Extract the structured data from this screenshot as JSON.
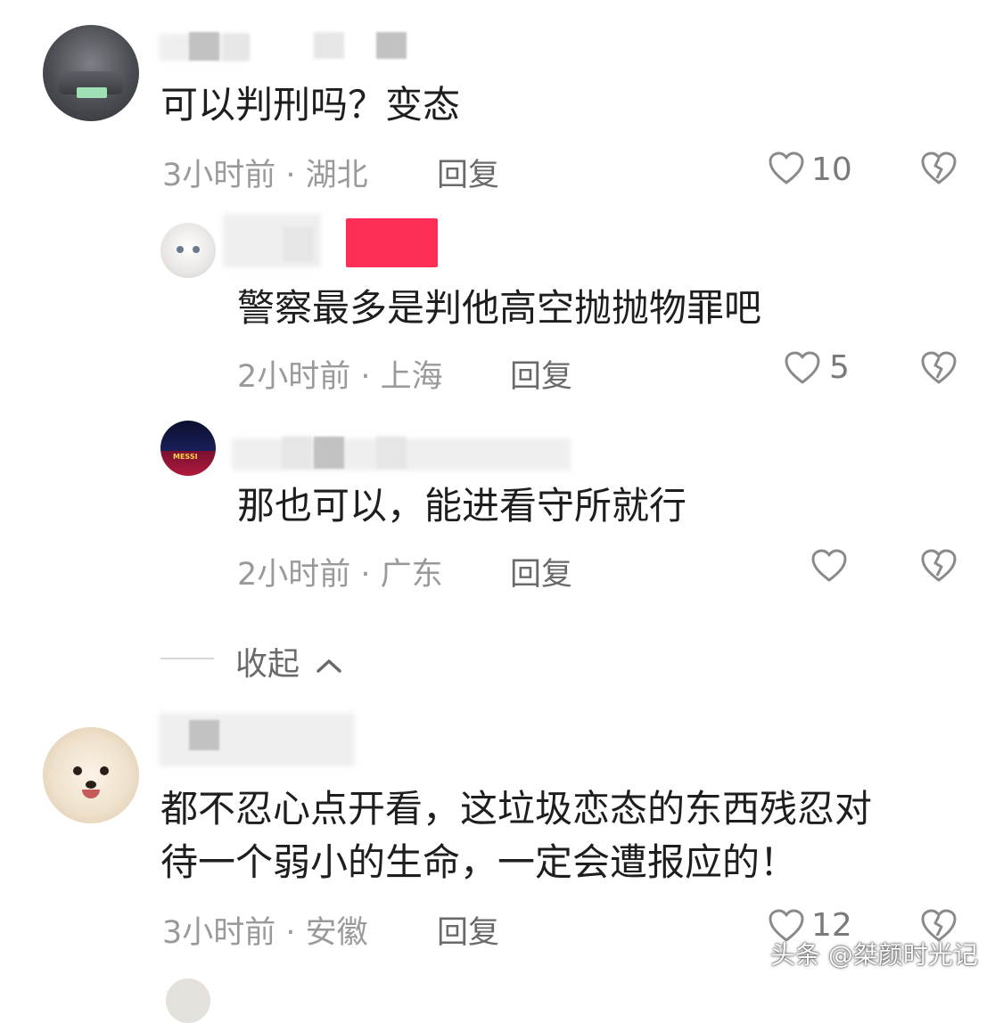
{
  "comments": [
    {
      "text": "可以判刑吗？变态",
      "meta": "3小时前 · 湖北",
      "reply_label": "回复",
      "likes": "10",
      "replies": [
        {
          "text": "警察最多是判他高空抛抛物罪吧",
          "meta": "2小时前 · 上海",
          "reply_label": "回复",
          "likes": "5"
        },
        {
          "text": "那也可以，能进看守所就行",
          "meta": "2小时前 · 广东",
          "reply_label": "回复",
          "likes": ""
        }
      ],
      "collapse_label": "收起"
    },
    {
      "text_line1": "都不忍心点开看，这垃圾恋态的东西残忍对",
      "text_line2": "待一个弱小的生命，一定会遭报应的！",
      "meta": "3小时前 · 安徽",
      "reply_label": "回复",
      "likes": "12"
    }
  ],
  "watermark": "头条 @桀颜时光记",
  "avatar_texts": {
    "messi": "MESSI"
  }
}
